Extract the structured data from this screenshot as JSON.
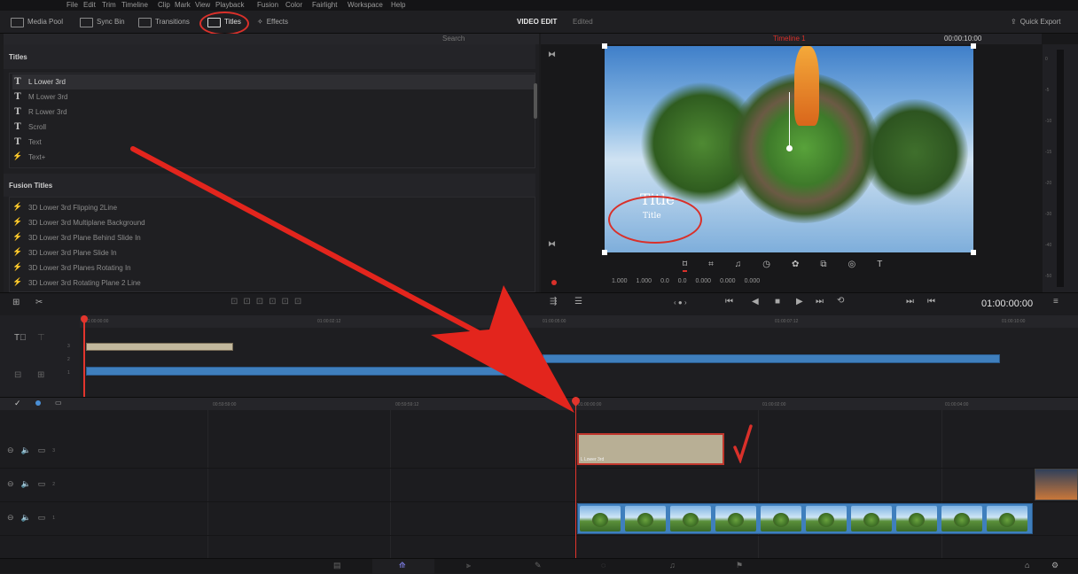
{
  "menu": [
    "File",
    "Edit",
    "Trim",
    "Timeline",
    "Clip",
    "Mark",
    "View",
    "Playback",
    "Fusion",
    "Color",
    "Fairlight",
    "Workspace",
    "Help"
  ],
  "toolbar": {
    "media_pool": "Media Pool",
    "sync_bin": "Sync Bin",
    "transitions": "Transitions",
    "titles": "Titles",
    "effects": "Effects",
    "project_name": "VIDEO EDIT",
    "project_status": "Edited",
    "quick_export": "Quick Export"
  },
  "effects_panel": {
    "search_placeholder": "Search",
    "titles_heading": "Titles",
    "titles": [
      "L Lower 3rd",
      "M Lower 3rd",
      "R Lower 3rd",
      "Scroll",
      "Text",
      "Text+"
    ],
    "fusion_heading": "Fusion Titles",
    "fusion_titles": [
      "3D Lower 3rd Flipping 2Line",
      "3D Lower 3rd Multiplane Background",
      "3D Lower 3rd Plane Behind Slide In",
      "3D Lower 3rd Plane Slide In",
      "3D Lower 3rd Planes Rotating In",
      "3D Lower 3rd Rotating Plane 2 Line"
    ]
  },
  "viewer": {
    "timeline_name": "Timeline 1",
    "duration": "00:00:10:00",
    "title_big": "Title",
    "title_small": "Title",
    "timecode": "01:00:00:00",
    "transform": {
      "zoom_x": "1.000",
      "zoom_y": "1.000",
      "pos_x": "0.0",
      "pos_y": "0.0",
      "rotation": "0.000",
      "anchor_x": "0.000",
      "anchor_y": "0.000"
    },
    "audio_scale": [
      "0",
      "-5",
      "-10",
      "-15",
      "-20",
      "-30",
      "-40",
      "-50"
    ]
  },
  "upper_timeline": {
    "ruler": [
      "01:00:00:00",
      "01:00:02:12",
      "01:00:05:00",
      "01:00:07:12",
      "01:00:10:00"
    ],
    "track_nums": [
      "3",
      "2",
      "1"
    ]
  },
  "lower_timeline": {
    "ruler": [
      "00:59:59:00",
      "00:59:59:12",
      "01:00:00:00",
      "01:00:02:00",
      "01:00:04:00"
    ],
    "title_clip_label": "L Lower 3rd",
    "track_nums": [
      "3",
      "2",
      "1"
    ]
  },
  "colors": {
    "accent_red": "#d9302a",
    "clip_blue": "#3f7fbd",
    "clip_beige": "#c2b89d",
    "playhead": "#e2352d"
  },
  "icons": [
    "media-pool-icon",
    "sync-bin-icon",
    "transitions-icon",
    "titles-icon",
    "effects-icon",
    "export-icon",
    "play-icon",
    "stop-icon",
    "prev-icon",
    "next-icon",
    "loop-icon",
    "lock-icon",
    "speaker-icon",
    "monitor-icon"
  ]
}
